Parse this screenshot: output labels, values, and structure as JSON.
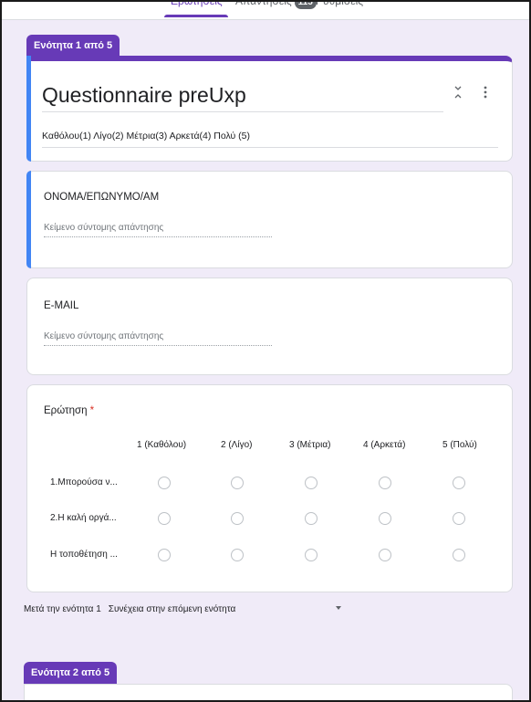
{
  "tabs": [
    {
      "label": "Ερωτήσεις",
      "active": true
    },
    {
      "label": "Απαντήσεις",
      "badge": "115"
    },
    {
      "label": "Ρυθμίσεις"
    }
  ],
  "section1": {
    "pill": "Ενότητα 1 από 5",
    "title": "Questionnaire preUxp",
    "description": "Καθόλου(1) Λίγο(2)  Μέτρια(3) Αρκετά(4)  Πολύ (5)"
  },
  "questions": {
    "name": {
      "title": "ΟΝΟΜΑ/ΕΠΩΝΥΜΟ/ΑΜ",
      "placeholder": "Κείμενο σύντομης απάντησης"
    },
    "email": {
      "title": "E-MAIL",
      "placeholder": "Κείμενο σύντομης απάντησης"
    },
    "grid": {
      "title": "Ερώτηση",
      "required_mark": "*",
      "columns": [
        "1 (Καθόλου)",
        "2 (Λίγο)",
        "3 (Μέτρια)",
        "4 (Αρκετά)",
        "5 (Πολύ)"
      ],
      "rows": [
        "1.Μπορούσα ν...",
        "2.Η καλή οργά...",
        "Η τοποθέτηση ..."
      ]
    }
  },
  "after_section": {
    "label": "Μετά την ενότητα 1",
    "value": "Συνέχεια στην επόμενη ενότητα"
  },
  "section2": {
    "pill": "Ενότητα 2 από 5"
  },
  "colors": {
    "accent": "#673ab7",
    "focus": "#4285f4",
    "background": "#f0ebf8"
  }
}
